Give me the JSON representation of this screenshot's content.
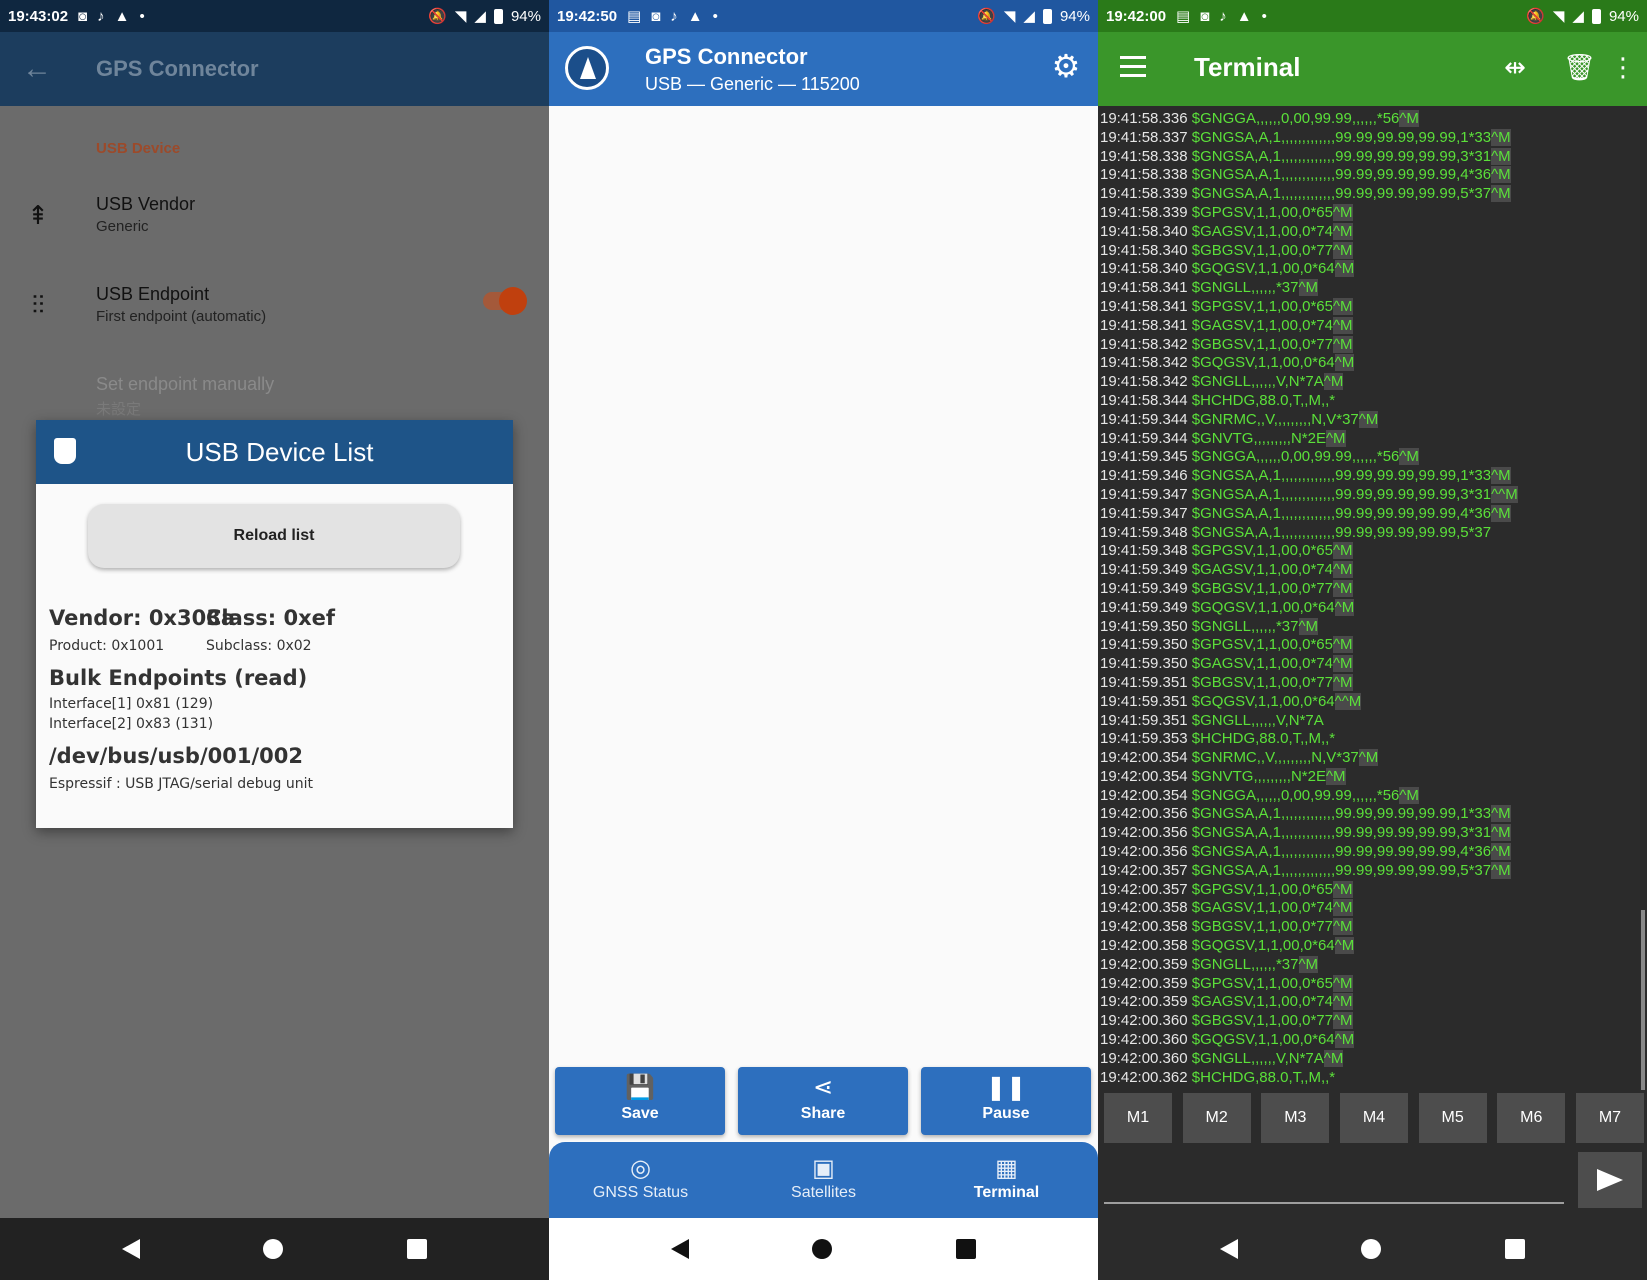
{
  "screen1": {
    "status": {
      "time": "19:43:02",
      "battery": "94%"
    },
    "appbar": {
      "title": "GPS Connector",
      "back_icon": "arrow-left-icon"
    },
    "category": "USB Device",
    "prefs": [
      {
        "title": "USB Vendor",
        "subtitle": "Generic",
        "icon": "usb-icon"
      },
      {
        "title": "USB Endpoint",
        "subtitle": "First endpoint (automatic)",
        "icon": "tune-icon",
        "toggle_on": true
      },
      {
        "title": "Set endpoint manually",
        "subtitle": "未設定"
      }
    ],
    "dialog": {
      "title": "USB Device List",
      "reload_label": "Reload list",
      "vendor": "Vendor: 0x303a",
      "class": "Class: 0xef",
      "product": "Product: 0x1001",
      "subclass": "Subclass: 0x02",
      "endpoints_title": "Bulk Endpoints (read)",
      "interface1": "Interface[1] 0x81 (129)",
      "interface2": "Interface[2] 0x83 (131)",
      "path": "/dev/bus/usb/001/002",
      "description": "Espressif : USB JTAG/serial debug unit"
    }
  },
  "screen2": {
    "status": {
      "time": "19:42:50",
      "battery": "94%"
    },
    "appbar": {
      "title": "GPS Connector",
      "subtitle": "USB — Generic — 115200"
    },
    "buttons": [
      {
        "label": "Save",
        "icon": "save-icon"
      },
      {
        "label": "Share",
        "icon": "share-icon"
      },
      {
        "label": "Pause",
        "icon": "pause-icon"
      }
    ],
    "nav": [
      {
        "label": "GNSS Status",
        "icon": "crosshair-icon"
      },
      {
        "label": "Satellites",
        "icon": "image-icon"
      },
      {
        "label": "Terminal",
        "icon": "terminal-icon",
        "active": true
      }
    ]
  },
  "screen3": {
    "status": {
      "time": "19:42:00",
      "battery": "94%"
    },
    "appbar": {
      "title": "Terminal"
    },
    "log": [
      [
        "19:41:58.336",
        "$GNGGA,,,,,,0,00,99.99,,,,,,*56",
        "^M"
      ],
      [
        "19:41:58.337",
        "$GNGSA,A,1,,,,,,,,,,,,,99.99,99.99,99.99,1*33",
        "^M"
      ],
      [
        "19:41:58.338",
        "$GNGSA,A,1,,,,,,,,,,,,,99.99,99.99,99.99,3*31",
        "^M"
      ],
      [
        "19:41:58.338",
        "$GNGSA,A,1,,,,,,,,,,,,,99.99,99.99,99.99,4*36",
        "^M"
      ],
      [
        "19:41:58.339",
        "$GNGSA,A,1,,,,,,,,,,,,,99.99,99.99,99.99,5*37",
        "^M"
      ],
      [
        "19:41:58.339",
        "$GPGSV,1,1,00,0*65",
        "^M"
      ],
      [
        "19:41:58.340",
        "$GAGSV,1,1,00,0*74",
        "^M"
      ],
      [
        "19:41:58.340",
        "$GBGSV,1,1,00,0*77",
        "^M"
      ],
      [
        "19:41:58.340",
        "$GQGSV,1,1,00,0*64",
        "^M"
      ],
      [
        "19:41:58.341",
        "$GNGLL,,,,,,*37",
        "^M"
      ],
      [
        "19:41:58.341",
        "$GPGSV,1,1,00,0*65",
        "^M"
      ],
      [
        "19:41:58.341",
        "$GAGSV,1,1,00,0*74",
        "^M"
      ],
      [
        "19:41:58.342",
        "$GBGSV,1,1,00,0*77",
        "^M"
      ],
      [
        "19:41:58.342",
        "$GQGSV,1,1,00,0*64",
        "^M"
      ],
      [
        "19:41:58.342",
        "$GNGLL,,,,,,V,N*7A",
        "^M"
      ],
      [
        "19:41:58.344",
        "$HCHDG,88.0,T,,M,,*",
        ""
      ],
      [
        "19:41:59.344",
        "$GNRMC,,V,,,,,,,,,N,V*37",
        "^M"
      ],
      [
        "19:41:59.344",
        "$GNVTG,,,,,,,,,N*2E",
        "^M"
      ],
      [
        "19:41:59.345",
        "$GNGGA,,,,,,0,00,99.99,,,,,,*56",
        "^M"
      ],
      [
        "19:41:59.346",
        "$GNGSA,A,1,,,,,,,,,,,,,99.99,99.99,99.99,1*33",
        "^M"
      ],
      [
        "19:41:59.347",
        "$GNGSA,A,1,,,,,,,,,,,,,99.99,99.99,99.99,3*31",
        "^^M"
      ],
      [
        "19:41:59.347",
        "$GNGSA,A,1,,,,,,,,,,,,,99.99,99.99,99.99,4*36",
        "^M"
      ],
      [
        "19:41:59.348",
        "$GNGSA,A,1,,,,,,,,,,,,,99.99,99.99,99.99,5*37",
        ""
      ],
      [
        "19:41:59.348",
        "$GPGSV,1,1,00,0*65",
        "^M"
      ],
      [
        "19:41:59.349",
        "$GAGSV,1,1,00,0*74",
        "^M"
      ],
      [
        "19:41:59.349",
        "$GBGSV,1,1,00,0*77",
        "^M"
      ],
      [
        "19:41:59.349",
        "$GQGSV,1,1,00,0*64",
        "^M"
      ],
      [
        "19:41:59.350",
        "$GNGLL,,,,,,*37",
        "^M"
      ],
      [
        "19:41:59.350",
        "$GPGSV,1,1,00,0*65",
        "^M"
      ],
      [
        "19:41:59.350",
        "$GAGSV,1,1,00,0*74",
        "^M"
      ],
      [
        "19:41:59.351",
        "$GBGSV,1,1,00,0*77",
        "^M"
      ],
      [
        "19:41:59.351",
        "$GQGSV,1,1,00,0*64",
        "^^M"
      ],
      [
        "19:41:59.351",
        "$GNGLL,,,,,,V,N*7A",
        ""
      ],
      [
        "19:41:59.353",
        "$HCHDG,88.0,T,,M,,*",
        ""
      ],
      [
        "19:42:00.354",
        "$GNRMC,,V,,,,,,,,,N,V*37",
        "^M"
      ],
      [
        "19:42:00.354",
        "$GNVTG,,,,,,,,,N*2E",
        "^M"
      ],
      [
        "19:42:00.354",
        "$GNGGA,,,,,,0,00,99.99,,,,,,*56",
        "^M"
      ],
      [
        "19:42:00.356",
        "$GNGSA,A,1,,,,,,,,,,,,,99.99,99.99,99.99,1*33",
        "^M"
      ],
      [
        "19:42:00.356",
        "$GNGSA,A,1,,,,,,,,,,,,,99.99,99.99,99.99,3*31",
        "^M"
      ],
      [
        "19:42:00.356",
        "$GNGSA,A,1,,,,,,,,,,,,,99.99,99.99,99.99,4*36",
        "^M"
      ],
      [
        "19:42:00.357",
        "$GNGSA,A,1,,,,,,,,,,,,,99.99,99.99,99.99,5*37",
        "^M"
      ],
      [
        "19:42:00.357",
        "$GPGSV,1,1,00,0*65",
        "^M"
      ],
      [
        "19:42:00.358",
        "$GAGSV,1,1,00,0*74",
        "^M"
      ],
      [
        "19:42:00.358",
        "$GBGSV,1,1,00,0*77",
        "^M"
      ],
      [
        "19:42:00.358",
        "$GQGSV,1,1,00,0*64",
        "^M"
      ],
      [
        "19:42:00.359",
        "$GNGLL,,,,,,*37",
        "^M"
      ],
      [
        "19:42:00.359",
        "$GPGSV,1,1,00,0*65",
        "^M"
      ],
      [
        "19:42:00.359",
        "$GAGSV,1,1,00,0*74",
        "^M"
      ],
      [
        "19:42:00.360",
        "$GBGSV,1,1,00,0*77",
        "^M"
      ],
      [
        "19:42:00.360",
        "$GQGSV,1,1,00,0*64",
        "^M"
      ],
      [
        "19:42:00.360",
        "$GNGLL,,,,,,V,N*7A",
        "^M"
      ],
      [
        "19:42:00.362",
        "$HCHDG,88.0,T,,M,,*",
        ""
      ]
    ],
    "macros": [
      "M1",
      "M2",
      "M3",
      "M4",
      "M5",
      "M6",
      "M7"
    ]
  },
  "colors": {
    "blue_bar": "#2d6fbe",
    "green_bar": "#3a962a",
    "log_green": "#5be03a",
    "accent_orange": "#c0400e"
  }
}
